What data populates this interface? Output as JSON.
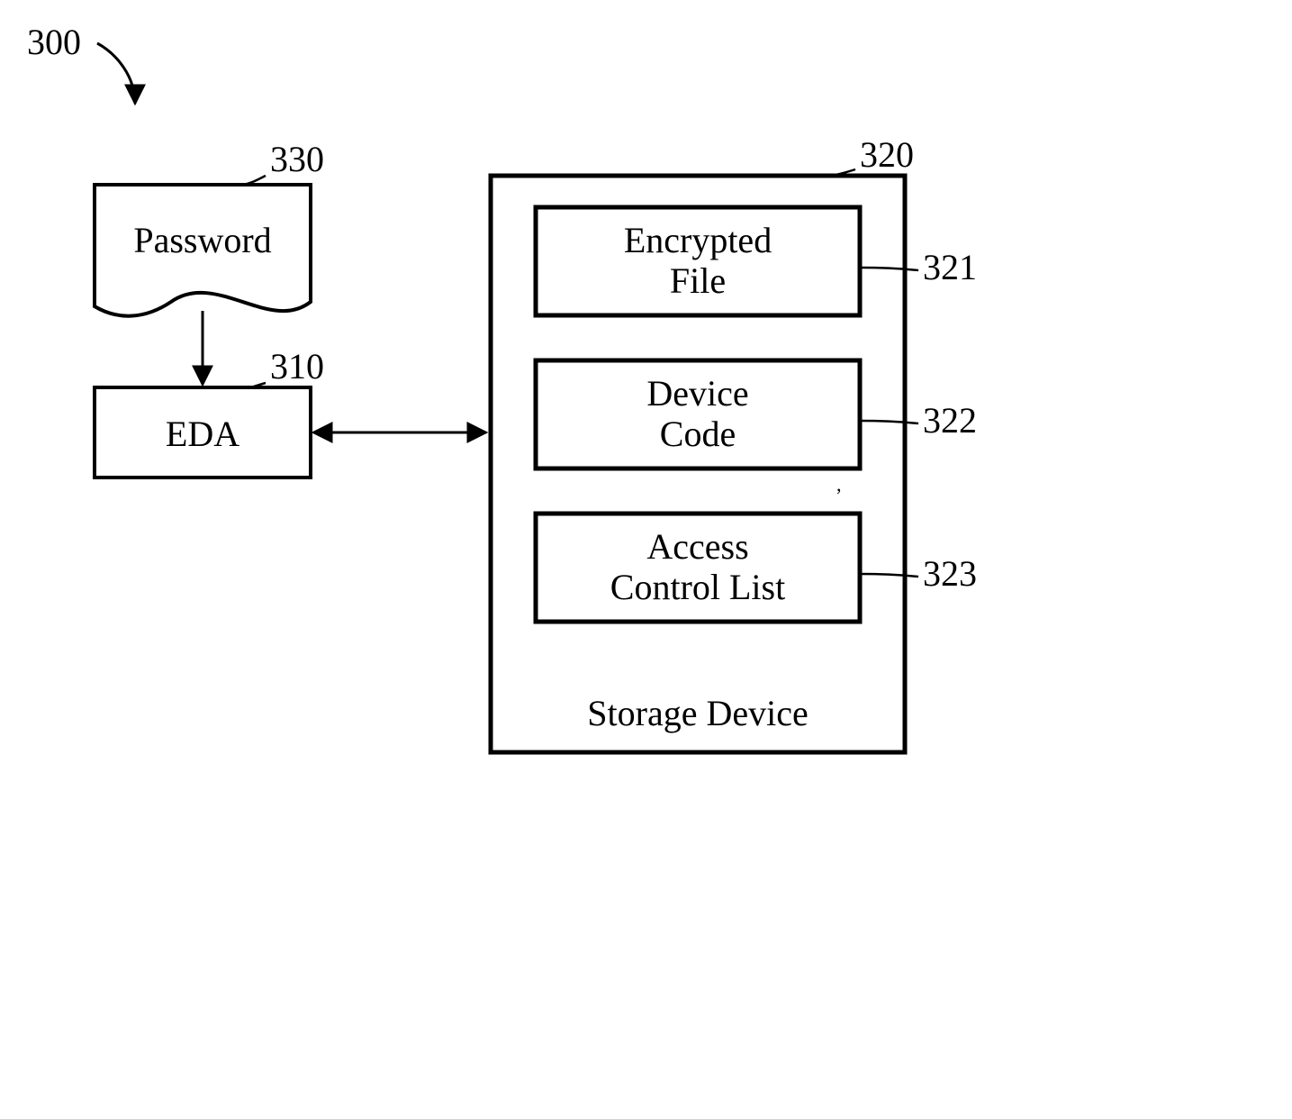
{
  "figure_ref": "300",
  "password": {
    "ref": "330",
    "label": "Password"
  },
  "eda": {
    "ref": "310",
    "label": "EDA"
  },
  "storage_device": {
    "ref": "320",
    "title": "Storage Device",
    "items": [
      {
        "ref": "321",
        "line1": "Encrypted",
        "line2": "File"
      },
      {
        "ref": "322",
        "line1": "Device",
        "line2": "Code"
      },
      {
        "ref": "323",
        "line1": "Access",
        "line2": "Control List"
      }
    ]
  }
}
